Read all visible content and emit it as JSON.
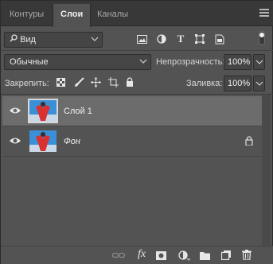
{
  "tabs": [
    {
      "label": "Контуры",
      "active": false
    },
    {
      "label": "Слои",
      "active": true
    },
    {
      "label": "Каналы",
      "active": false
    }
  ],
  "filter": {
    "label": "Вид",
    "icons": [
      "image-filter-icon",
      "adjustment-filter-icon",
      "type-filter-icon",
      "shape-filter-icon",
      "smart-object-filter-icon",
      "filter-toggle-icon"
    ]
  },
  "blend": {
    "mode": "Обычные",
    "opacity_label": "Непрозрачность:",
    "opacity_value": "100%"
  },
  "lock": {
    "label": "Закрепить:",
    "fill_label": "Заливка:",
    "fill_value": "100%"
  },
  "layers": [
    {
      "name": "Слой 1",
      "selected": true,
      "locked": false,
      "italic": false
    },
    {
      "name": "Фон",
      "selected": false,
      "locked": true,
      "italic": true
    }
  ],
  "footer_icons": [
    "link-layers-icon",
    "fx-icon",
    "layer-mask-icon",
    "adjustment-layer-icon",
    "group-folder-icon",
    "new-layer-icon",
    "trash-icon"
  ],
  "footer": {
    "fx_label": "fx"
  },
  "colors": {
    "panel": "#535353",
    "tabbar": "#383838",
    "selected_layer": "#6c6c6c",
    "thumb_sky": "#3a8fd6",
    "thumb_figure": "#d93030"
  }
}
